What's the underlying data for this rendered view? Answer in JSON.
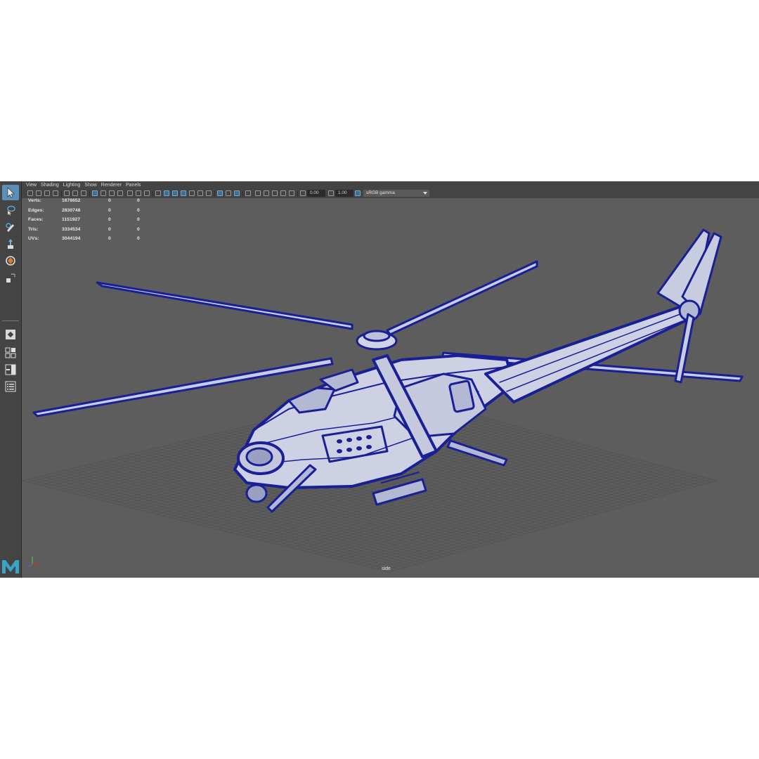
{
  "menu": [
    "View",
    "Shading",
    "Lighting",
    "Show",
    "Renderer",
    "Panels"
  ],
  "exposure": "0.00",
  "gamma": "1.00",
  "color_space": "sRGB gamma",
  "stats": [
    {
      "label": "Verts:",
      "count": "1676652",
      "selected": "0",
      "tris_selected": "0"
    },
    {
      "label": "Edges:",
      "count": "2830748",
      "selected": "0",
      "tris_selected": "0"
    },
    {
      "label": "Faces:",
      "count": "1151927",
      "selected": "0",
      "tris_selected": "0"
    },
    {
      "label": "Tris:",
      "count": "3334534",
      "selected": "0",
      "tris_selected": "0"
    },
    {
      "label": "UVs:",
      "count": "3044194",
      "selected": "0",
      "tris_selected": "0"
    }
  ],
  "camera": "side",
  "tools": [
    "select-tool-icon",
    "lasso-tool-icon",
    "paint-select-icon",
    "move-tool-icon",
    "rotate-tool-icon",
    "scale-tool-icon"
  ],
  "colors": {
    "wire": "#1a1f96",
    "ui_bg": "#444444",
    "viewport_bg": "#5d5d5d",
    "accent": "#5b8fb9"
  }
}
